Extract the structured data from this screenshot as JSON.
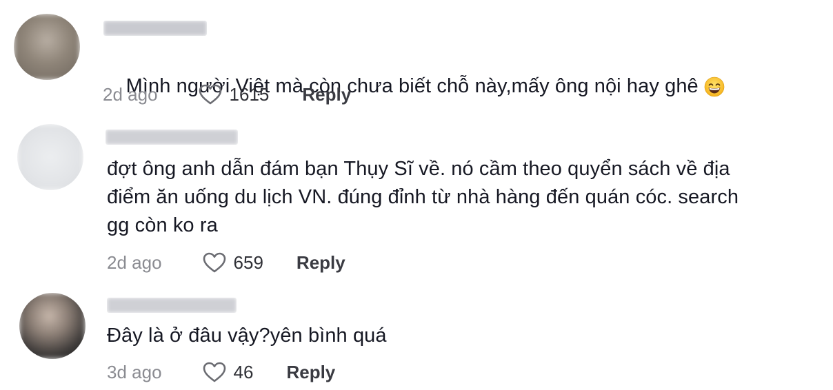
{
  "comments": [
    {
      "text": "Mình người Việt mà còn chưa biết chỗ này,mấy ông nội hay ghê",
      "emoji": "grinning-face-with-smiling-eyes",
      "time": "2d ago",
      "likes": "1615",
      "reply_label": "Reply"
    },
    {
      "text": "đợt ông anh dẫn đám bạn Thụy Sĩ về. nó cầm theo quyển sách về địa\nđiểm ăn uống du lịch VN. đúng đỉnh từ nhà hàng đến quán cóc. search\ngg còn ko ra",
      "time": "2d ago",
      "likes": "659",
      "reply_label": "Reply"
    },
    {
      "text": "Đây là ở đâu vậy?yên bình quá",
      "time": "3d ago",
      "likes": "46",
      "reply_label": "Reply"
    }
  ],
  "colors": {
    "text": "#161823",
    "muted": "#8a8b91",
    "reply": "#3a3b42"
  }
}
